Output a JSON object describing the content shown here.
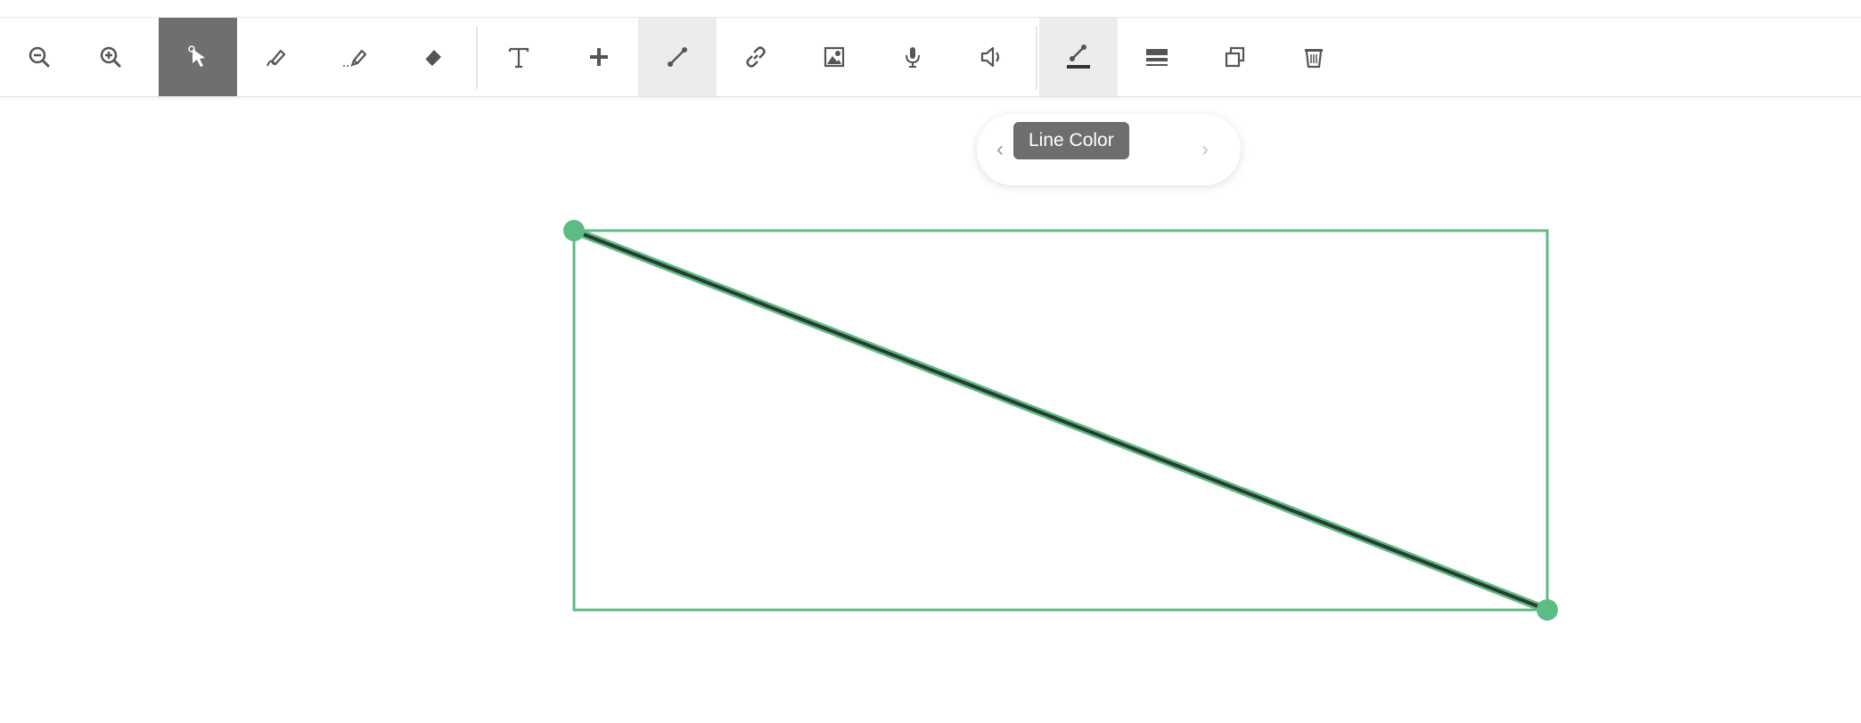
{
  "toolbar": {
    "tools": [
      {
        "name": "zoom-out",
        "icon": "zoom-out-icon"
      },
      {
        "name": "zoom-in",
        "icon": "zoom-in-icon"
      },
      {
        "name": "select",
        "icon": "select-cursor-icon",
        "state": "active"
      },
      {
        "name": "pen",
        "icon": "pen-icon"
      },
      {
        "name": "highlighter",
        "icon": "highlighter-icon"
      },
      {
        "name": "eraser",
        "icon": "eraser-icon"
      },
      {
        "name": "text",
        "icon": "text-icon"
      },
      {
        "name": "add",
        "icon": "plus-icon"
      },
      {
        "name": "line",
        "icon": "line-icon",
        "state": "highlighted"
      },
      {
        "name": "link",
        "icon": "link-icon"
      },
      {
        "name": "image",
        "icon": "image-icon"
      },
      {
        "name": "record-audio",
        "icon": "microphone-icon"
      },
      {
        "name": "audio",
        "icon": "speaker-icon"
      },
      {
        "name": "line-color",
        "icon": "line-color-icon",
        "state": "highlighted"
      },
      {
        "name": "line-weight",
        "icon": "line-weight-icon"
      },
      {
        "name": "duplicate",
        "icon": "duplicate-icon"
      },
      {
        "name": "delete",
        "icon": "trash-icon"
      }
    ]
  },
  "popover": {
    "prev_label": "‹",
    "next_label": "›"
  },
  "tooltip": {
    "text": "Line Color"
  },
  "colors": {
    "selection": "#5dbb85",
    "line_stroke": "#2c3b32",
    "icon": "#555555",
    "active_tool_bg": "#6f6f6f"
  }
}
